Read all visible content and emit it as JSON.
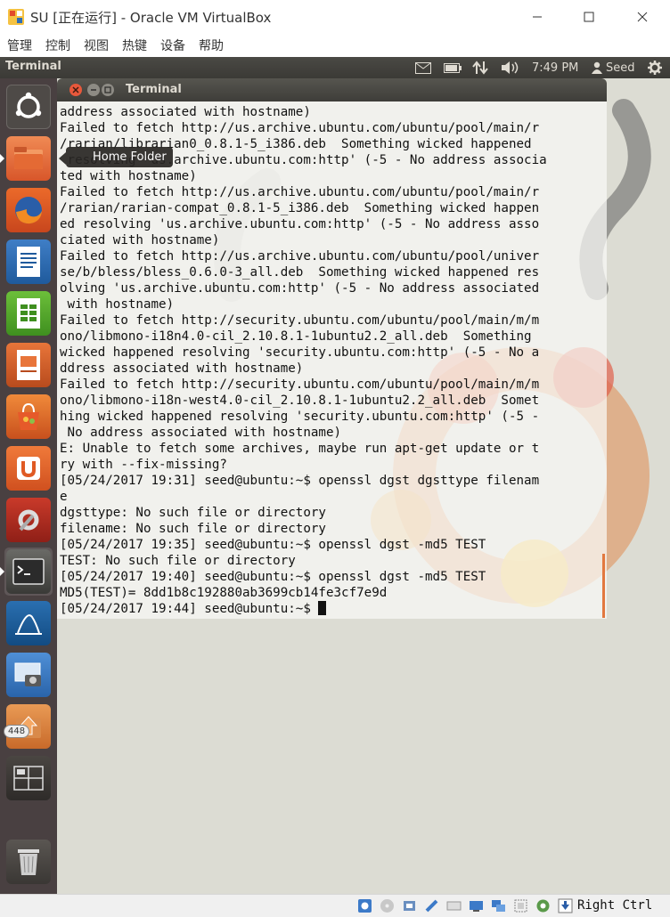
{
  "host": {
    "title": "SU [正在运行] - Oracle VM VirtualBox",
    "menu": [
      "管理",
      "控制",
      "视图",
      "热键",
      "设备",
      "帮助"
    ],
    "host_key": "Right Ctrl"
  },
  "panel": {
    "title": "Terminal",
    "clock": "7:49 PM",
    "user": "Seed"
  },
  "launcher": {
    "tooltip": "Home Folder",
    "update_badge": "448",
    "items": [
      "dash-home-icon",
      "files-icon",
      "firefox-icon",
      "libreoffice-writer-icon",
      "libreoffice-calc-icon",
      "libreoffice-impress-icon",
      "software-center-icon",
      "ubuntu-one-icon",
      "system-settings-icon",
      "terminal-icon",
      "wireshark-icon",
      "screenshot-icon",
      "software-updater-icon",
      "workspace-switcher-icon",
      "trash-icon"
    ]
  },
  "terminal": {
    "title": "Terminal",
    "lines": [
      "address associated with hostname)",
      "Failed to fetch http://us.archive.ubuntu.com/ubuntu/pool/main/r",
      "/rarian/librarian0_0.8.1-5_i386.deb  Something wicked happened",
      " resolving 'us.archive.ubuntu.com:http' (-5 - No address associa",
      "ted with hostname)",
      "Failed to fetch http://us.archive.ubuntu.com/ubuntu/pool/main/r",
      "/rarian/rarian-compat_0.8.1-5_i386.deb  Something wicked happen",
      "ed resolving 'us.archive.ubuntu.com:http' (-5 - No address asso",
      "ciated with hostname)",
      "Failed to fetch http://us.archive.ubuntu.com/ubuntu/pool/univer",
      "se/b/bless/bless_0.6.0-3_all.deb  Something wicked happened res",
      "olving 'us.archive.ubuntu.com:http' (-5 - No address associated",
      " with hostname)",
      "Failed to fetch http://security.ubuntu.com/ubuntu/pool/main/m/m",
      "ono/libmono-i18n4.0-cil_2.10.8.1-1ubuntu2.2_all.deb  Something",
      "wicked happened resolving 'security.ubuntu.com:http' (-5 - No a",
      "ddress associated with hostname)",
      "Failed to fetch http://security.ubuntu.com/ubuntu/pool/main/m/m",
      "ono/libmono-i18n-west4.0-cil_2.10.8.1-1ubuntu2.2_all.deb  Somet",
      "hing wicked happened resolving 'security.ubuntu.com:http' (-5 -",
      " No address associated with hostname)",
      "E: Unable to fetch some archives, maybe run apt-get update or t",
      "ry with --fix-missing?",
      "[05/24/2017 19:31] seed@ubuntu:~$ openssl dgst dgsttype filenam",
      "e",
      "dgsttype: No such file or directory",
      "filename: No such file or directory",
      "[05/24/2017 19:35] seed@ubuntu:~$ openssl dgst -md5 TEST",
      "TEST: No such file or directory",
      "[05/24/2017 19:40] seed@ubuntu:~$ openssl dgst -md5 TEST",
      "MD5(TEST)= 8dd1b8c192880ab3699cb14fe3cf7e9d"
    ],
    "prompt": "[05/24/2017 19:44] seed@ubuntu:~$ "
  },
  "colors": {
    "panel_bg": "#3c3b37",
    "launcher_bg": "#3c3234",
    "ubuntu_orange": "#e95420",
    "desktop_bg": "#dcdcd3"
  }
}
